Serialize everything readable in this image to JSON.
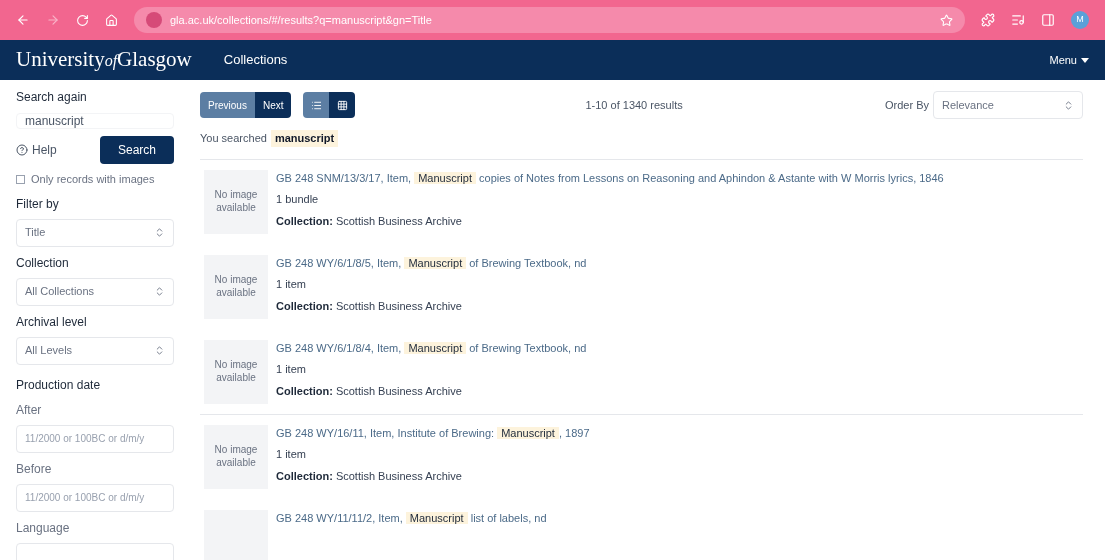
{
  "browser": {
    "url": "gla.ac.uk/collections/#/results?q=manuscript&gn=Title",
    "profile": "M"
  },
  "header": {
    "logo_main": "University",
    "logo_of": "of",
    "logo_end": "Glasgow",
    "nav": "Collections",
    "menu": "Menu"
  },
  "sidebar": {
    "search_label": "Search again",
    "search_value": "manuscript",
    "help": "Help",
    "search_button": "Search",
    "images_only": {
      "label": "Only records with images",
      "checked": false
    },
    "filters": [
      {
        "kind": "select",
        "label": "Filter by",
        "value": "Title"
      },
      {
        "kind": "select",
        "label": "Collection",
        "value": "All Collections"
      },
      {
        "kind": "select",
        "label": "Archival level",
        "value": "All Levels"
      },
      {
        "kind": "heading",
        "label": "Production date"
      },
      {
        "kind": "input",
        "label": "After",
        "placeholder": "11/2000 or 100BC or d/m/y"
      },
      {
        "kind": "input",
        "label": "Before",
        "placeholder": "11/2000 or 100BC or d/m/y"
      },
      {
        "kind": "input",
        "label": "Language"
      }
    ]
  },
  "toolbar": {
    "pager": [
      {
        "label": "Previous",
        "selected": false
      },
      {
        "label": "Next",
        "selected": true
      }
    ],
    "views": [
      {
        "kind": "list",
        "selected": false
      },
      {
        "kind": "grid",
        "selected": true
      }
    ],
    "count": "1-10 of 1340 results",
    "order_label": "Order By",
    "order_value": "Relevance"
  },
  "searched": {
    "label": "You searched",
    "term": "manuscript"
  },
  "results": [
    {
      "thumb": "No image available",
      "before": "GB 248 SNM/13/3/17, Item, ",
      "highlight": "Manuscript",
      "after": " copies of Notes from Lessons on Reasoning and Aphindon & Astante with W Morris lyrics, 1846",
      "extent": "1 bundle",
      "collection_label": "Collection:",
      "collection": "Scottish Business Archive",
      "divider": true
    },
    {
      "thumb": "No image available",
      "before": "GB 248 WY/6/1/8/5, Item, ",
      "highlight": "Manuscript",
      "after": " of Brewing Textbook, nd",
      "extent": "1 item",
      "collection_label": "Collection:",
      "collection": "Scottish Business Archive",
      "divider": false
    },
    {
      "thumb": "No image available",
      "before": "GB 248 WY/6/1/8/4, Item, ",
      "highlight": "Manuscript",
      "after": " of Brewing Textbook, nd",
      "extent": "1 item",
      "collection_label": "Collection:",
      "collection": "Scottish Business Archive",
      "divider": false
    },
    {
      "thumb": "No image available",
      "before": "GB 248 WY/16/11, Item, Institute of Brewing: ",
      "highlight": "Manuscript",
      "after": ", 1897",
      "extent": "1 item",
      "collection_label": "Collection:",
      "collection": "Scottish Business Archive",
      "divider": true
    },
    {
      "before": "GB 248 WY/11/11/2, Item, ",
      "highlight": "Manuscript",
      "after": " list of labels, nd",
      "divider": false
    }
  ]
}
